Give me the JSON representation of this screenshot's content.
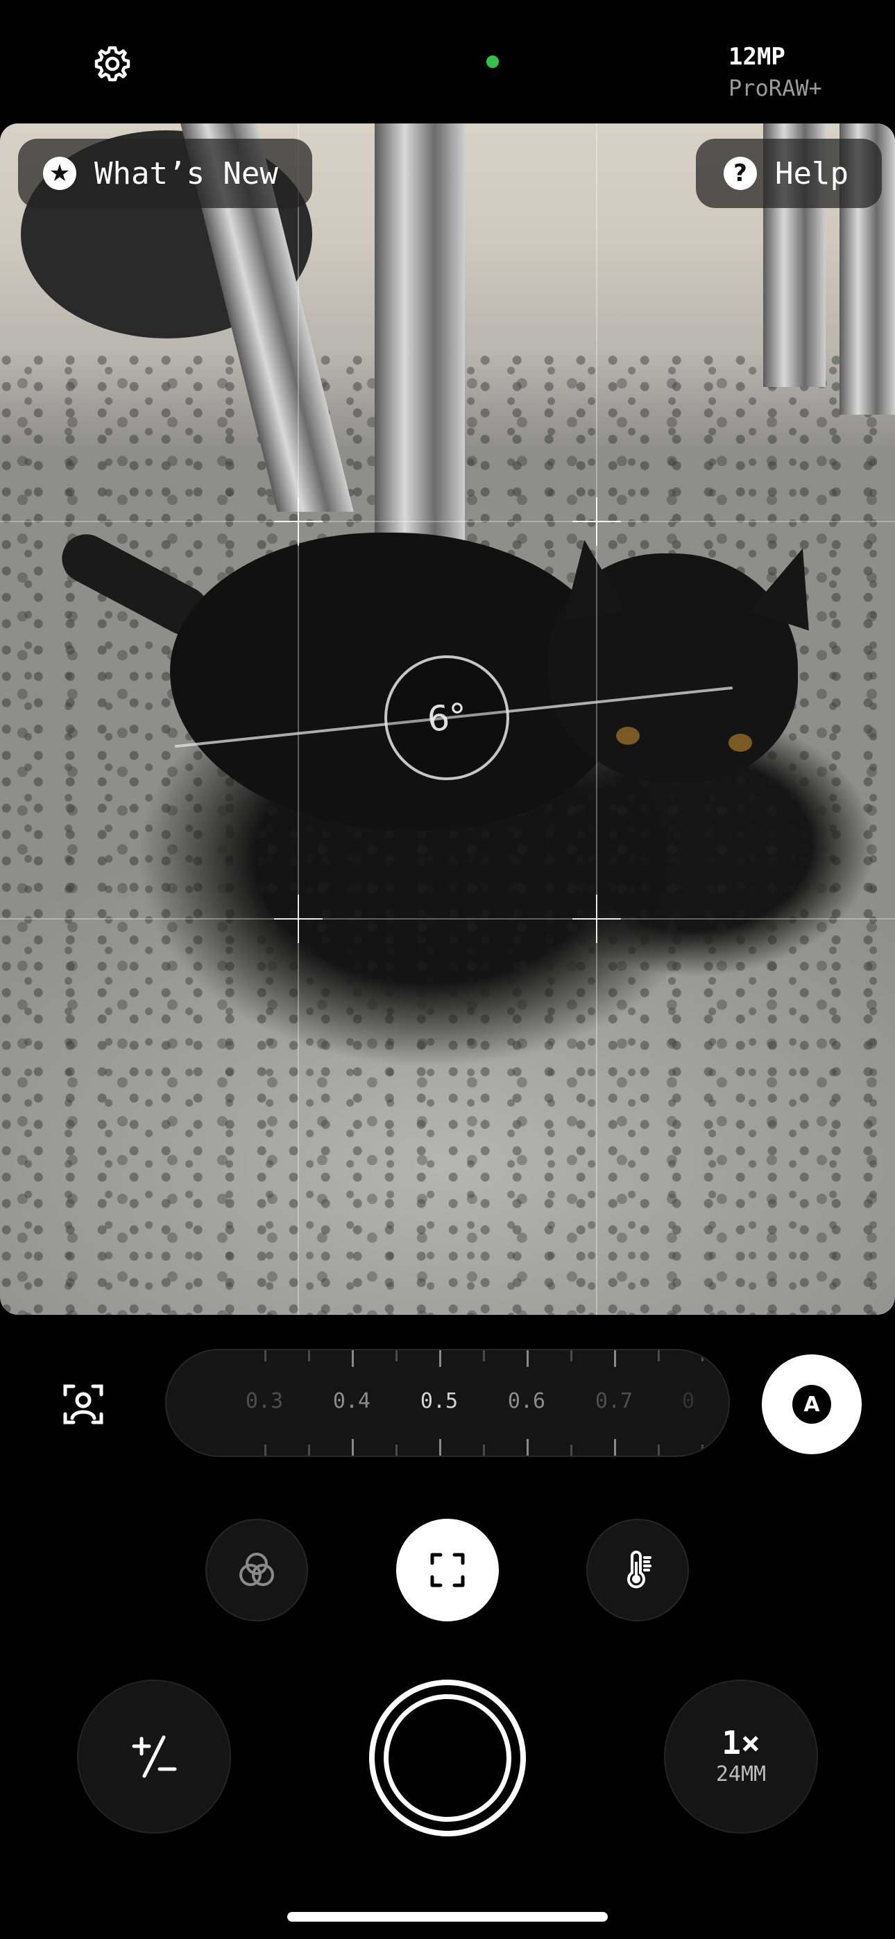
{
  "status": {
    "resolution": "12MP",
    "format": "ProRAW+",
    "indicator_color": "#30c24b"
  },
  "viewfinder": {
    "whats_new_label": "What’s New",
    "help_label": "Help",
    "level_angle": "6°",
    "level_degrees": 6
  },
  "focus": {
    "ticks": [
      "0.3",
      "0.4",
      "0.5",
      "0.6",
      "0.7",
      "0"
    ],
    "selected": "0.5",
    "mode_badge": "A"
  },
  "controls": {
    "zoom_factor": "1×",
    "focal_length": "24MM"
  },
  "icons": {
    "settings": "gear-icon",
    "face_detect": "face-frame-icon",
    "filters": "overlapping-circles-icon",
    "frame": "frame-corners-icon",
    "white_balance": "thermometer-icon",
    "exposure": "plus-minus-icon"
  }
}
